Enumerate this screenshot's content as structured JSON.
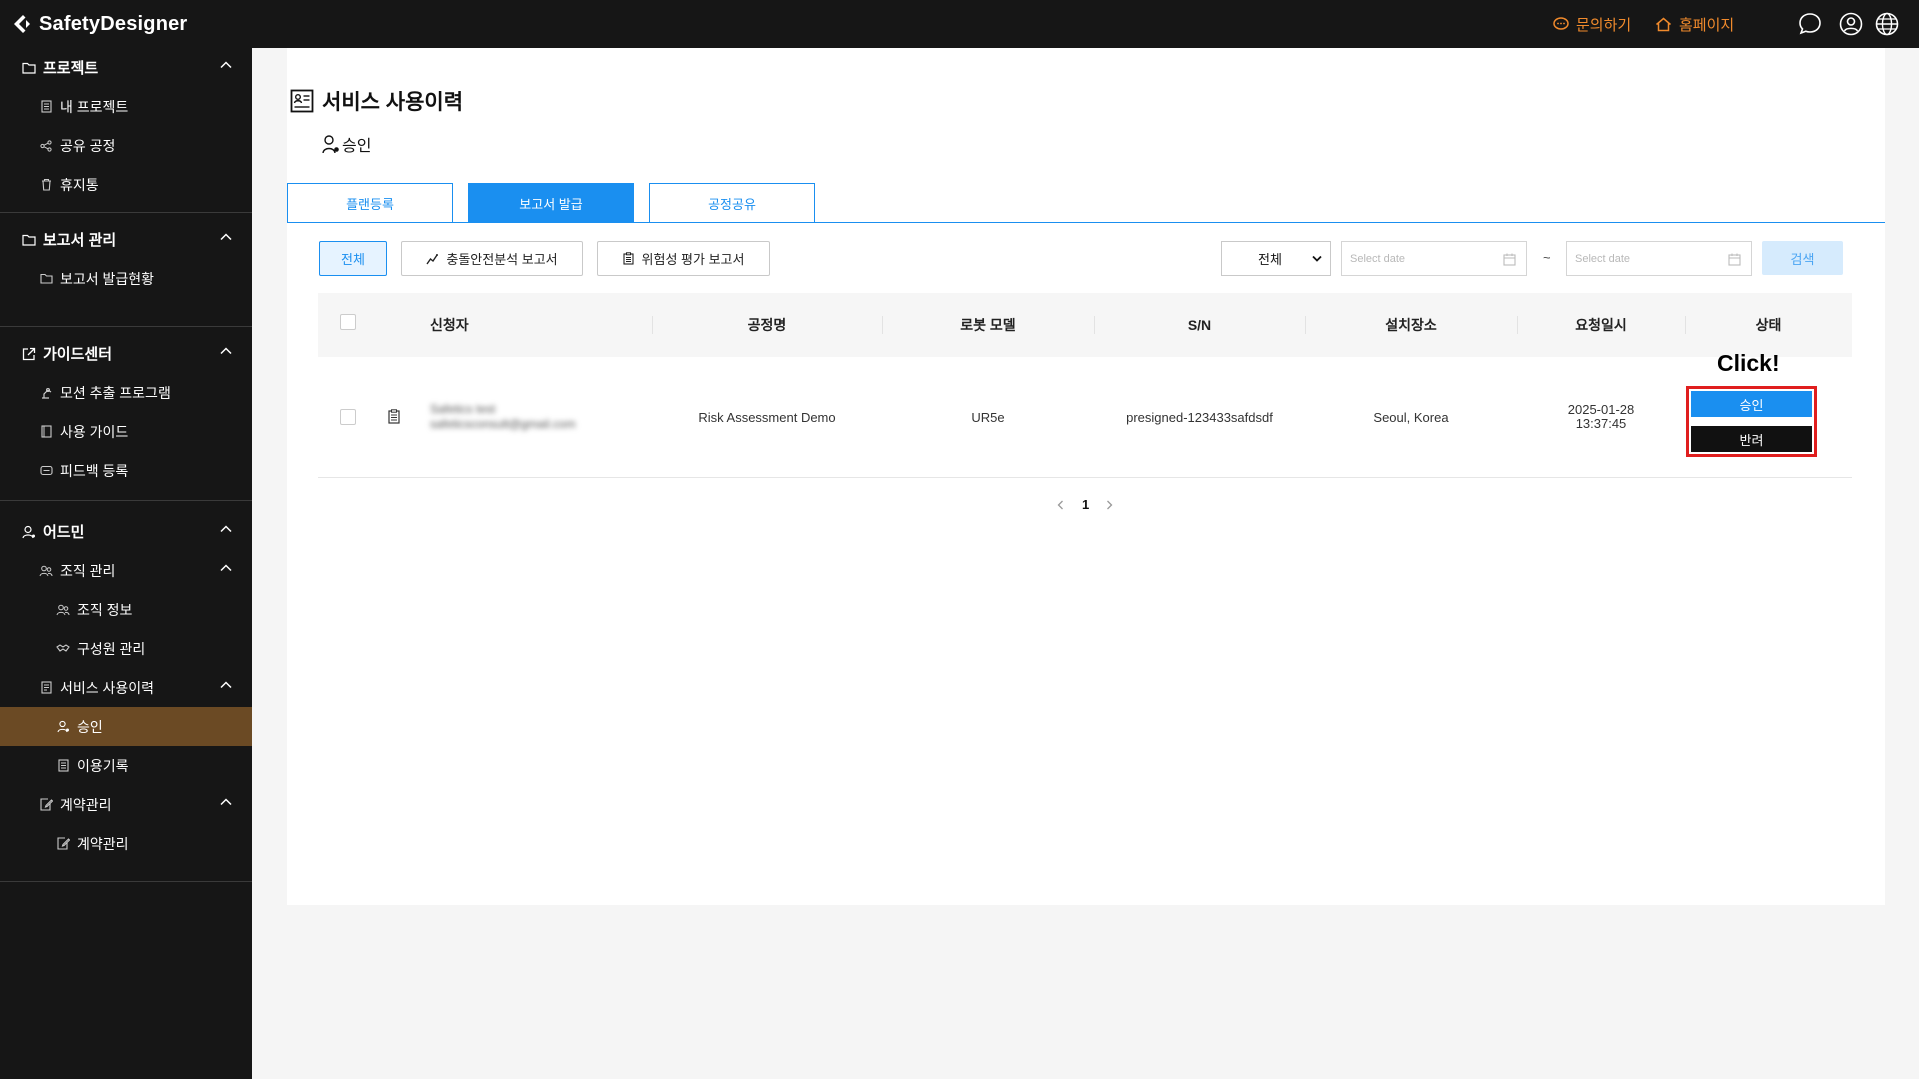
{
  "app": {
    "title": "SafetyDesigner",
    "inquiry_label": "문의하기",
    "homepage_label": "홈페이지",
    "accent_color": "#f08a2c"
  },
  "sidebar": {
    "project": {
      "label": "프로젝트",
      "items": [
        "내 프로젝트",
        "공유 공정",
        "휴지통"
      ]
    },
    "report": {
      "label": "보고서 관리",
      "items": [
        "보고서 발급현황"
      ]
    },
    "guide": {
      "label": "가이드센터",
      "items": [
        "모션 추출 프로그램",
        "사용 가이드",
        "피드백 등록"
      ]
    },
    "admin": {
      "label": "어드민",
      "org": {
        "label": "조직 관리",
        "items": [
          "조직 정보",
          "구성원 관리"
        ]
      },
      "service": {
        "label": "서비스 사용이력",
        "items": [
          "승인",
          "이용기록"
        ]
      },
      "contract": {
        "label": "계약관리",
        "items": [
          "계약관리"
        ]
      }
    }
  },
  "page": {
    "title": "서비스 사용이력",
    "subtitle": "승인",
    "tabs": [
      "플랜등록",
      "보고서 발급",
      "공정공유"
    ],
    "active_tab": 1
  },
  "filters": {
    "all": "전체",
    "collision_report": "충돌안전분석 보고서",
    "risk_report": "위험성 평가 보고서",
    "select_value": "전체",
    "date_placeholder": "Select date",
    "tilde": "~",
    "search": "검색"
  },
  "table": {
    "headers": [
      "신청자",
      "공정명",
      "로봇 모델",
      "S/N",
      "설치장소",
      "요청일시",
      "상태"
    ],
    "rows": [
      {
        "applicant_name": "Safetics test",
        "applicant_email": "safeticsconsult@gmail.com",
        "process": "Risk Assessment Demo",
        "robot_model": "UR5e",
        "sn": "presigned-123433safdsdf",
        "location": "Seoul, Korea",
        "date": "2025-01-28",
        "time": "13:37:45",
        "approve": "승인",
        "reject": "반려"
      }
    ]
  },
  "annotation": {
    "click": "Click!"
  },
  "pagination": {
    "current": "1"
  }
}
